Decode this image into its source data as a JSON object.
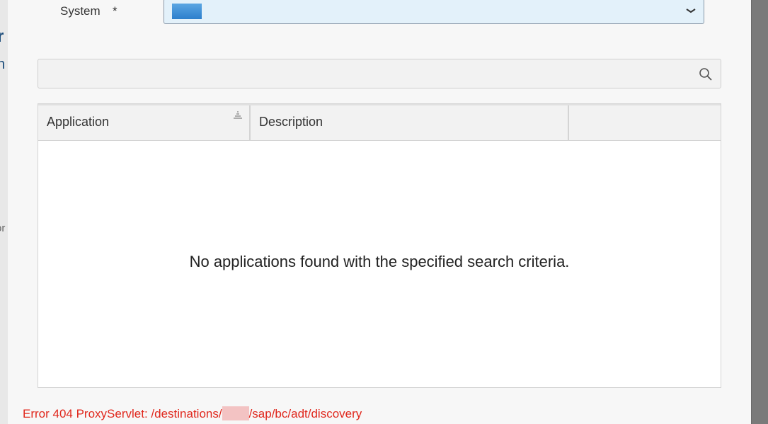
{
  "system_field": {
    "label": "System",
    "required_mark": "*"
  },
  "search": {
    "value": "",
    "placeholder": ""
  },
  "table": {
    "columns": [
      "Application",
      "Description",
      ""
    ],
    "empty_message": "No applications found with the specified search criteria."
  },
  "error": {
    "prefix": "Error 404 ProxyServlet: /destinations/",
    "suffix": "/sap/bc/adt/discovery"
  },
  "colors": {
    "accent": "#2d7fcc",
    "error": "#e0271c",
    "select_bg": "#e3f1fa"
  }
}
